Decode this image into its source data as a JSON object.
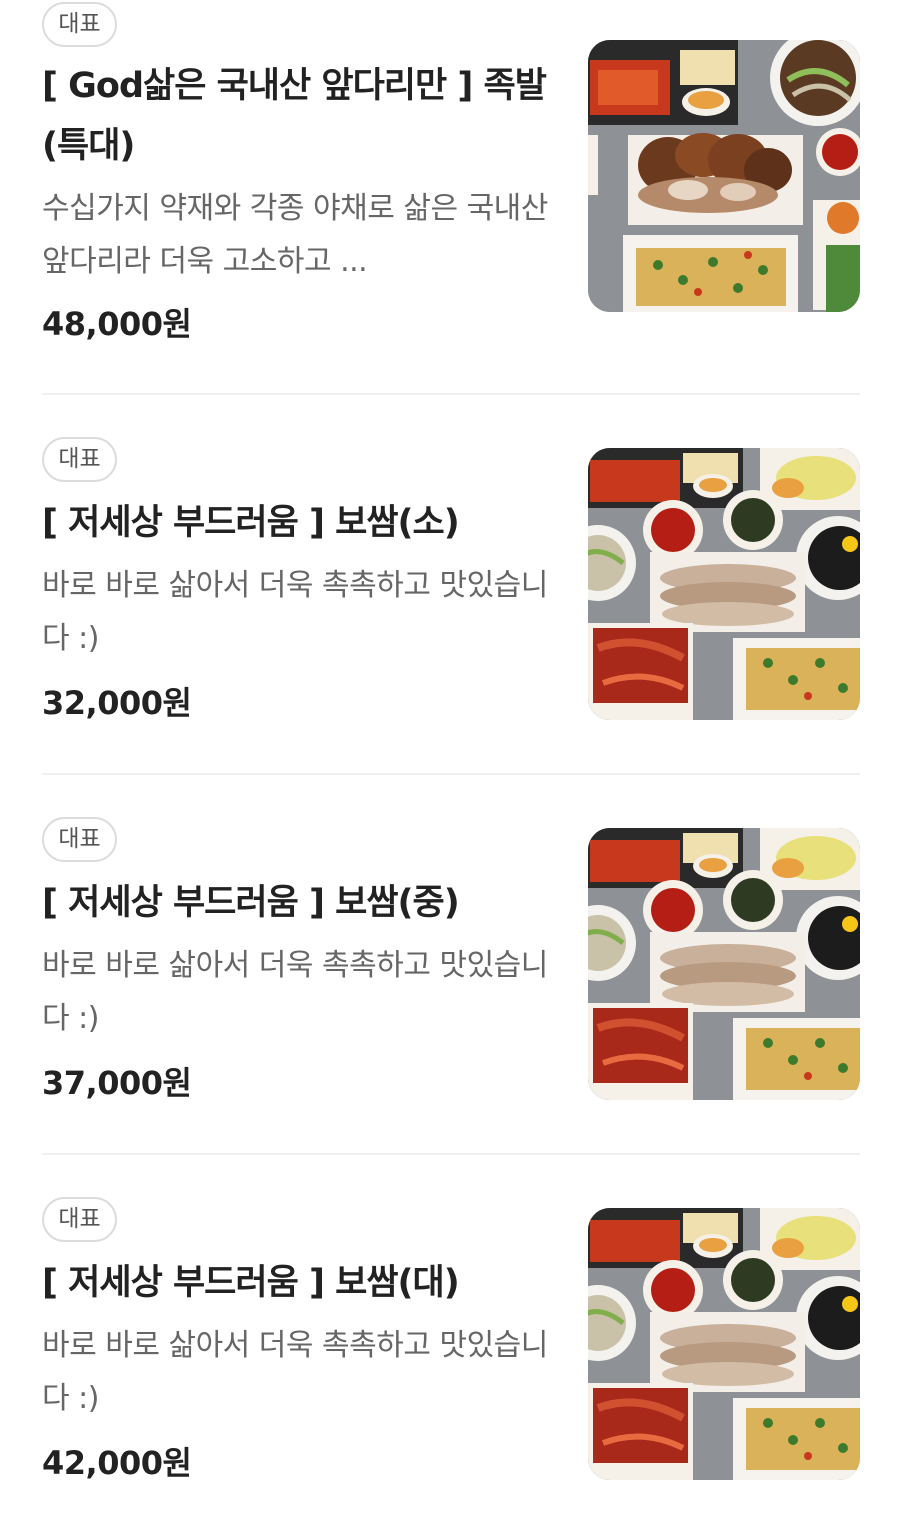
{
  "menu": {
    "items": [
      {
        "badge": "대표",
        "title": "[ God삶은 국내산 앞다리만 ] 족발(특대)",
        "description": "수십가지 약재와 각종 야채로 삶은 국내산 앞다리라 더욱 고소하고 ...",
        "price": "48,000원",
        "image": "jokbal-platter-photo"
      },
      {
        "badge": "대표",
        "title": "[ 저세상 부드러움 ] 보쌈(소)",
        "description": "바로 바로 삶아서 더욱 촉촉하고 맛있습니다 :)",
        "price": "32,000원",
        "image": "bossam-platter-photo"
      },
      {
        "badge": "대표",
        "title": "[ 저세상 부드러움 ] 보쌈(중)",
        "description": "바로 바로 삶아서 더욱 촉촉하고 맛있습니다 :)",
        "price": "37,000원",
        "image": "bossam-platter-photo"
      },
      {
        "badge": "대표",
        "title": "[ 저세상 부드러움 ] 보쌈(대)",
        "description": "바로 바로 삶아서 더욱 촉촉하고 맛있습니다 :)",
        "price": "42,000원",
        "image": "bossam-platter-photo"
      }
    ]
  }
}
